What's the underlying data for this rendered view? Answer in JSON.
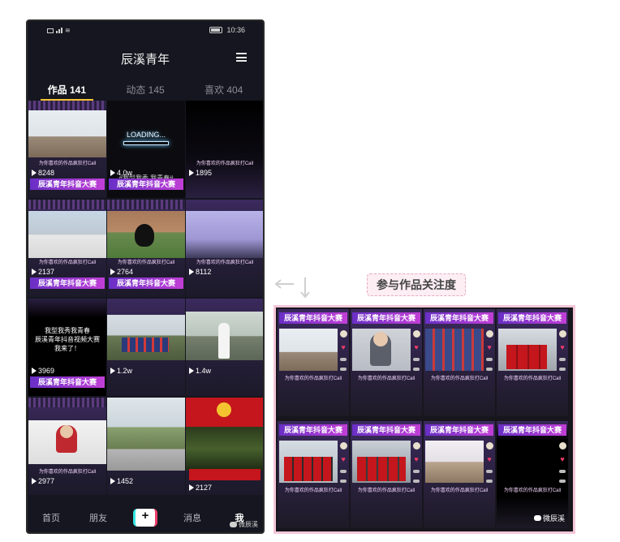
{
  "status": {
    "time": "10:36"
  },
  "header": {
    "title": "辰溪青年"
  },
  "tabs": [
    {
      "label": "作品 141"
    },
    {
      "label": "动态 145"
    },
    {
      "label": "喜欢 404"
    }
  ],
  "videos": [
    {
      "plays": "8248",
      "tag": "为你喜欢的作品疯狂打Call",
      "banner": "辰溪青年抖音大赛"
    },
    {
      "plays": "4.0w",
      "overlay": "#我型我秀 我青春#",
      "caption": "LOADING...",
      "banner": "辰溪青年抖音大赛"
    },
    {
      "plays": "1895",
      "tag": "为你喜欢的作品疯狂打Call",
      "banner": ""
    },
    {
      "plays": "2137",
      "tag": "为你喜欢的作品疯狂打Call",
      "banner": "辰溪青年抖音大赛"
    },
    {
      "plays": "2764",
      "tag": "为你喜欢的作品疯狂打Call",
      "banner": "辰溪青年抖音大赛"
    },
    {
      "plays": "8112",
      "tag": "为你喜欢的作品疯狂打Call",
      "banner": ""
    },
    {
      "plays": "3969",
      "caption": "我型我秀我青春\n辰溪青年抖音视频大赛\n我来了！",
      "banner": "辰溪青年抖音大赛"
    },
    {
      "plays": "1.2w",
      "tag": "",
      "banner": ""
    },
    {
      "plays": "1.4w",
      "tag": "",
      "banner": ""
    },
    {
      "plays": "2977",
      "tag": "为你喜欢的作品疯狂打Call",
      "banner": ""
    },
    {
      "plays": "1452",
      "tag": "",
      "banner": ""
    },
    {
      "plays": "2127",
      "tag": "",
      "banner": ""
    }
  ],
  "bottom_nav": [
    {
      "label": "首页"
    },
    {
      "label": "朋友"
    },
    {
      "label": "+"
    },
    {
      "label": "消息"
    },
    {
      "label": "我"
    }
  ],
  "watermark": "微辰溪",
  "annotation": {
    "label": "参与作品关注度"
  },
  "panel": {
    "banner": "辰溪青年抖音大赛",
    "tag": "为你喜欢的作品疯狂打Call",
    "watermark": "微辰溪"
  },
  "colors": {
    "accent": "#f4c430",
    "banner_start": "#6a2fc6",
    "banner_end": "#c13fd6",
    "heart": "#f03c6b"
  }
}
